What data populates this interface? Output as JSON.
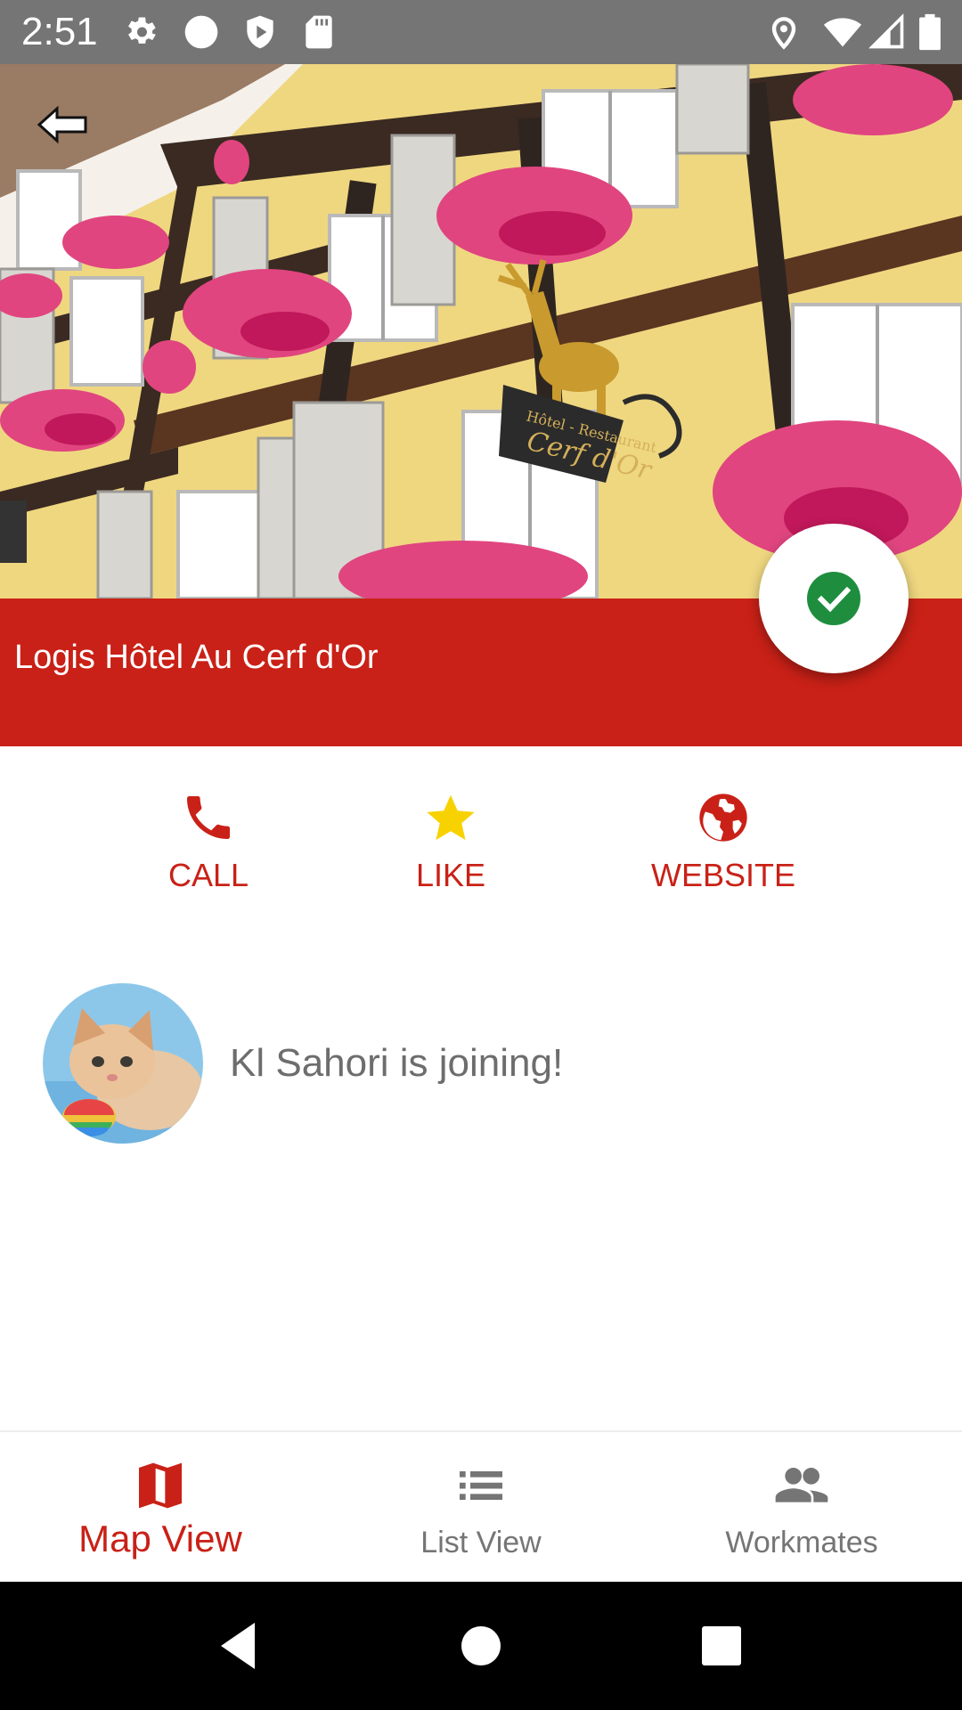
{
  "status_bar": {
    "time": "2:51",
    "left_icons": [
      "settings-icon",
      "circle-icon",
      "shield-play-icon",
      "sd-card-icon"
    ],
    "right_icons": [
      "location-icon",
      "wifi-icon",
      "signal-icon",
      "battery-icon"
    ]
  },
  "header": {
    "back_icon": "arrow-back-icon",
    "hotel_name": "Logis Hôtel Au Cerf d'Or",
    "photo_sign_top": "Hôtel - Restaurant",
    "photo_sign_main": "Cerf d'Or",
    "fab_icon": "check-circle-icon"
  },
  "actions": [
    {
      "label": "CALL",
      "icon": "phone-icon",
      "color": "#c92117"
    },
    {
      "label": "LIKE",
      "icon": "star-icon",
      "color": "#f8d200"
    },
    {
      "label": "WEBSITE",
      "icon": "globe-icon",
      "color": "#c92117"
    }
  ],
  "workmates_joining": [
    {
      "text": "Kl Sahori is joining!",
      "avatar": "kitten-avatar"
    }
  ],
  "bottom_nav": [
    {
      "label": "Map View",
      "icon": "map-icon",
      "active": true
    },
    {
      "label": "List View",
      "icon": "list-icon",
      "active": false
    },
    {
      "label": "Workmates",
      "icon": "people-icon",
      "active": false
    }
  ],
  "system_nav": [
    "back-triangle-icon",
    "home-circle-icon",
    "recents-square-icon"
  ],
  "colors": {
    "accent": "#c92117",
    "status_bar": "#757575",
    "star": "#f8d200",
    "check": "#1e8e3e",
    "inactive": "#757575"
  }
}
